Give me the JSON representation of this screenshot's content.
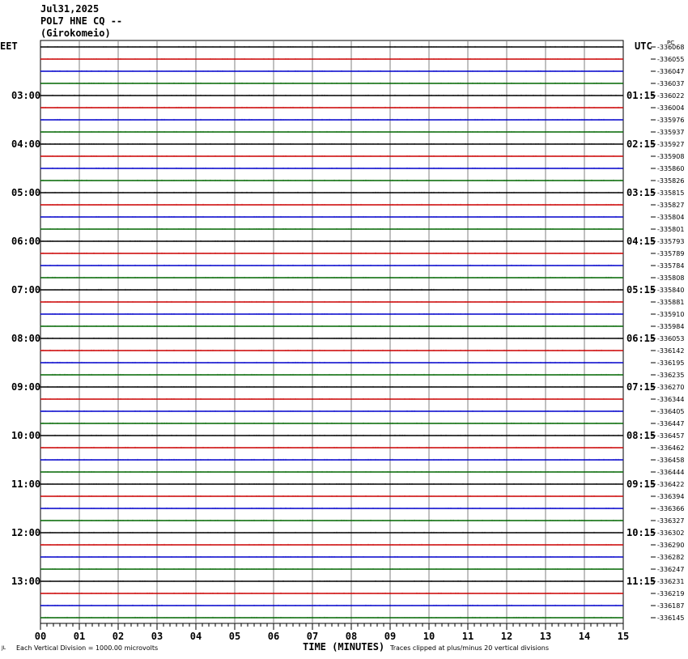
{
  "header": {
    "date": "Jul31,2025",
    "station": "POL7 HNE CQ --",
    "location": "(Girokomeio)"
  },
  "left_timezone": "EET",
  "right_timezone": "UTC",
  "top_right_mark": "PC",
  "footer": {
    "left_mark": "JL",
    "scale_note": "Each Vertical Division = 1000.00 microvolts",
    "axis_title": "TIME (MINUTES)",
    "clip_note": "Traces clipped at plus/minus 20 vertical divisions"
  },
  "colors": {
    "trace_cycle": [
      "#000000",
      "#cc0000",
      "#0000cc",
      "#006600"
    ],
    "grid": "#808080"
  },
  "chart_data": {
    "type": "line",
    "xlabel": "TIME (MINUTES)",
    "x_ticks": [
      "00",
      "01",
      "02",
      "03",
      "04",
      "05",
      "06",
      "07",
      "08",
      "09",
      "10",
      "11",
      "12",
      "13",
      "14",
      "15"
    ],
    "xlim": [
      0,
      15
    ],
    "left_hour_labels": [
      "03:00",
      "04:00",
      "05:00",
      "06:00",
      "07:00",
      "08:00",
      "09:00",
      "10:00",
      "11:00",
      "12:00",
      "13:00"
    ],
    "right_hour_labels": [
      "01:15",
      "02:15",
      "03:15",
      "04:15",
      "05:15",
      "06:15",
      "07:15",
      "08:15",
      "09:15",
      "10:15",
      "11:15"
    ],
    "trace_offsets": [
      "-336068",
      "-336055",
      "-336047",
      "-336037",
      "-336022",
      "-336004",
      "-335976",
      "-335937",
      "-335927",
      "-335908",
      "-335860",
      "-335826",
      "-335815",
      "-335827",
      "-335804",
      "-335801",
      "-335793",
      "-335789",
      "-335784",
      "-335808",
      "-335840",
      "-335881",
      "-335910",
      "-335984",
      "-336053",
      "-336142",
      "-336195",
      "-336235",
      "-336270",
      "-336344",
      "-336405",
      "-336447",
      "-336457",
      "-336462",
      "-336458",
      "-336444",
      "-336422",
      "-336394",
      "-336366",
      "-336327",
      "-336302",
      "-336290",
      "-336282",
      "-336247",
      "-336231",
      "-336219",
      "-336187",
      "-336145"
    ]
  }
}
